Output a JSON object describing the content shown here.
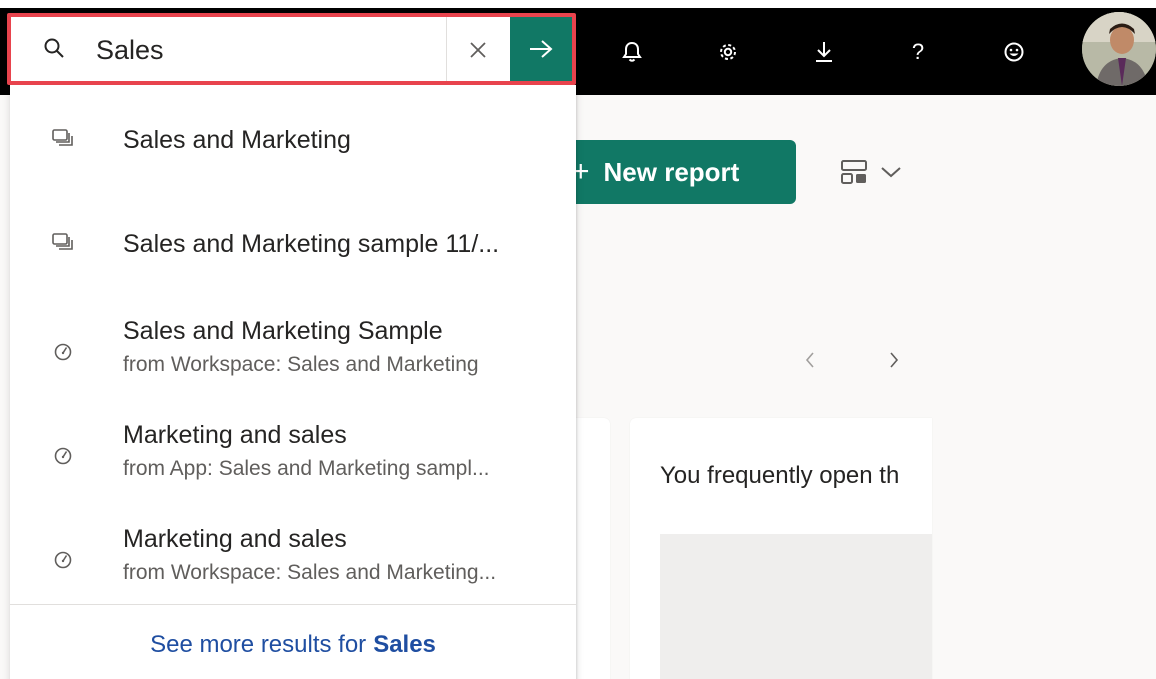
{
  "header": {
    "icons": [
      "bell-icon",
      "gear-icon",
      "download-icon",
      "help-icon",
      "smiley-icon"
    ],
    "help_glyph": "?"
  },
  "search": {
    "value": "Sales",
    "placeholder": "Search",
    "clear_glyph": "✕",
    "go_glyph": "→"
  },
  "results": [
    {
      "icon": "report-icon",
      "title": "Sales and Marketing",
      "subtitle": ""
    },
    {
      "icon": "report-icon",
      "title": "Sales and Marketing sample 11/...",
      "subtitle": ""
    },
    {
      "icon": "dashboard-icon",
      "title": "Sales and Marketing Sample",
      "subtitle": "from Workspace: Sales and Marketing"
    },
    {
      "icon": "dashboard-icon",
      "title": "Marketing and sales",
      "subtitle": "from App: Sales and Marketing sampl..."
    },
    {
      "icon": "dashboard-icon",
      "title": "Marketing and sales",
      "subtitle": "from Workspace: Sales and Marketing..."
    }
  ],
  "see_more": {
    "prefix": "See more results for",
    "term": "Sales"
  },
  "page": {
    "new_report_plus": "+",
    "new_report_label": "New report",
    "card_text": "You frequently open th",
    "prev_glyph": "‹",
    "next_glyph": "›"
  },
  "colors": {
    "accent": "#117865",
    "highlight_border": "#e8434d",
    "link": "#1f4ea1",
    "header_bg": "#000000"
  }
}
